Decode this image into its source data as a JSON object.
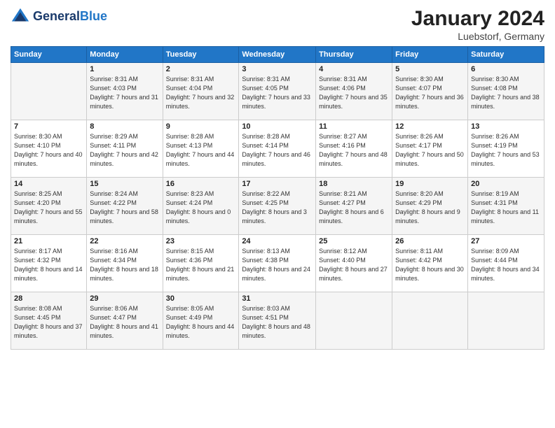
{
  "logo": {
    "line1": "General",
    "line2": "Blue"
  },
  "title": "January 2024",
  "location": "Luebstorf, Germany",
  "days_of_week": [
    "Sunday",
    "Monday",
    "Tuesday",
    "Wednesday",
    "Thursday",
    "Friday",
    "Saturday"
  ],
  "weeks": [
    [
      {
        "day": "",
        "sunrise": "",
        "sunset": "",
        "daylight": ""
      },
      {
        "day": "1",
        "sunrise": "Sunrise: 8:31 AM",
        "sunset": "Sunset: 4:03 PM",
        "daylight": "Daylight: 7 hours and 31 minutes."
      },
      {
        "day": "2",
        "sunrise": "Sunrise: 8:31 AM",
        "sunset": "Sunset: 4:04 PM",
        "daylight": "Daylight: 7 hours and 32 minutes."
      },
      {
        "day": "3",
        "sunrise": "Sunrise: 8:31 AM",
        "sunset": "Sunset: 4:05 PM",
        "daylight": "Daylight: 7 hours and 33 minutes."
      },
      {
        "day": "4",
        "sunrise": "Sunrise: 8:31 AM",
        "sunset": "Sunset: 4:06 PM",
        "daylight": "Daylight: 7 hours and 35 minutes."
      },
      {
        "day": "5",
        "sunrise": "Sunrise: 8:30 AM",
        "sunset": "Sunset: 4:07 PM",
        "daylight": "Daylight: 7 hours and 36 minutes."
      },
      {
        "day": "6",
        "sunrise": "Sunrise: 8:30 AM",
        "sunset": "Sunset: 4:08 PM",
        "daylight": "Daylight: 7 hours and 38 minutes."
      }
    ],
    [
      {
        "day": "7",
        "sunrise": "Sunrise: 8:30 AM",
        "sunset": "Sunset: 4:10 PM",
        "daylight": "Daylight: 7 hours and 40 minutes."
      },
      {
        "day": "8",
        "sunrise": "Sunrise: 8:29 AM",
        "sunset": "Sunset: 4:11 PM",
        "daylight": "Daylight: 7 hours and 42 minutes."
      },
      {
        "day": "9",
        "sunrise": "Sunrise: 8:28 AM",
        "sunset": "Sunset: 4:13 PM",
        "daylight": "Daylight: 7 hours and 44 minutes."
      },
      {
        "day": "10",
        "sunrise": "Sunrise: 8:28 AM",
        "sunset": "Sunset: 4:14 PM",
        "daylight": "Daylight: 7 hours and 46 minutes."
      },
      {
        "day": "11",
        "sunrise": "Sunrise: 8:27 AM",
        "sunset": "Sunset: 4:16 PM",
        "daylight": "Daylight: 7 hours and 48 minutes."
      },
      {
        "day": "12",
        "sunrise": "Sunrise: 8:26 AM",
        "sunset": "Sunset: 4:17 PM",
        "daylight": "Daylight: 7 hours and 50 minutes."
      },
      {
        "day": "13",
        "sunrise": "Sunrise: 8:26 AM",
        "sunset": "Sunset: 4:19 PM",
        "daylight": "Daylight: 7 hours and 53 minutes."
      }
    ],
    [
      {
        "day": "14",
        "sunrise": "Sunrise: 8:25 AM",
        "sunset": "Sunset: 4:20 PM",
        "daylight": "Daylight: 7 hours and 55 minutes."
      },
      {
        "day": "15",
        "sunrise": "Sunrise: 8:24 AM",
        "sunset": "Sunset: 4:22 PM",
        "daylight": "Daylight: 7 hours and 58 minutes."
      },
      {
        "day": "16",
        "sunrise": "Sunrise: 8:23 AM",
        "sunset": "Sunset: 4:24 PM",
        "daylight": "Daylight: 8 hours and 0 minutes."
      },
      {
        "day": "17",
        "sunrise": "Sunrise: 8:22 AM",
        "sunset": "Sunset: 4:25 PM",
        "daylight": "Daylight: 8 hours and 3 minutes."
      },
      {
        "day": "18",
        "sunrise": "Sunrise: 8:21 AM",
        "sunset": "Sunset: 4:27 PM",
        "daylight": "Daylight: 8 hours and 6 minutes."
      },
      {
        "day": "19",
        "sunrise": "Sunrise: 8:20 AM",
        "sunset": "Sunset: 4:29 PM",
        "daylight": "Daylight: 8 hours and 9 minutes."
      },
      {
        "day": "20",
        "sunrise": "Sunrise: 8:19 AM",
        "sunset": "Sunset: 4:31 PM",
        "daylight": "Daylight: 8 hours and 11 minutes."
      }
    ],
    [
      {
        "day": "21",
        "sunrise": "Sunrise: 8:17 AM",
        "sunset": "Sunset: 4:32 PM",
        "daylight": "Daylight: 8 hours and 14 minutes."
      },
      {
        "day": "22",
        "sunrise": "Sunrise: 8:16 AM",
        "sunset": "Sunset: 4:34 PM",
        "daylight": "Daylight: 8 hours and 18 minutes."
      },
      {
        "day": "23",
        "sunrise": "Sunrise: 8:15 AM",
        "sunset": "Sunset: 4:36 PM",
        "daylight": "Daylight: 8 hours and 21 minutes."
      },
      {
        "day": "24",
        "sunrise": "Sunrise: 8:13 AM",
        "sunset": "Sunset: 4:38 PM",
        "daylight": "Daylight: 8 hours and 24 minutes."
      },
      {
        "day": "25",
        "sunrise": "Sunrise: 8:12 AM",
        "sunset": "Sunset: 4:40 PM",
        "daylight": "Daylight: 8 hours and 27 minutes."
      },
      {
        "day": "26",
        "sunrise": "Sunrise: 8:11 AM",
        "sunset": "Sunset: 4:42 PM",
        "daylight": "Daylight: 8 hours and 30 minutes."
      },
      {
        "day": "27",
        "sunrise": "Sunrise: 8:09 AM",
        "sunset": "Sunset: 4:44 PM",
        "daylight": "Daylight: 8 hours and 34 minutes."
      }
    ],
    [
      {
        "day": "28",
        "sunrise": "Sunrise: 8:08 AM",
        "sunset": "Sunset: 4:45 PM",
        "daylight": "Daylight: 8 hours and 37 minutes."
      },
      {
        "day": "29",
        "sunrise": "Sunrise: 8:06 AM",
        "sunset": "Sunset: 4:47 PM",
        "daylight": "Daylight: 8 hours and 41 minutes."
      },
      {
        "day": "30",
        "sunrise": "Sunrise: 8:05 AM",
        "sunset": "Sunset: 4:49 PM",
        "daylight": "Daylight: 8 hours and 44 minutes."
      },
      {
        "day": "31",
        "sunrise": "Sunrise: 8:03 AM",
        "sunset": "Sunset: 4:51 PM",
        "daylight": "Daylight: 8 hours and 48 minutes."
      },
      {
        "day": "",
        "sunrise": "",
        "sunset": "",
        "daylight": ""
      },
      {
        "day": "",
        "sunrise": "",
        "sunset": "",
        "daylight": ""
      },
      {
        "day": "",
        "sunrise": "",
        "sunset": "",
        "daylight": ""
      }
    ]
  ]
}
